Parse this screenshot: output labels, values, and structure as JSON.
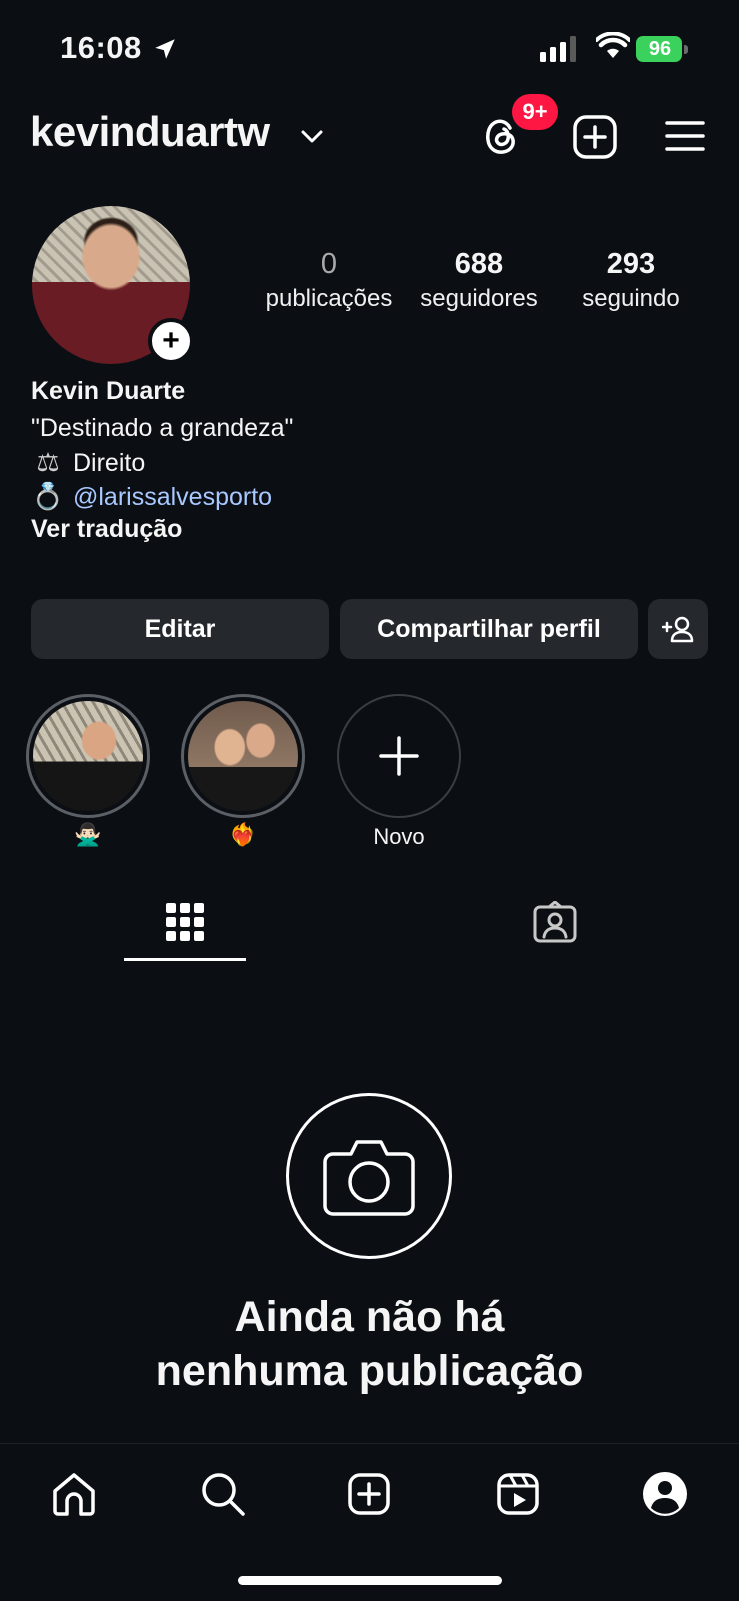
{
  "status_bar": {
    "time": "16:08",
    "battery": "96",
    "icons": [
      "location-arrow-icon",
      "cellular-signal-icon",
      "wifi-icon",
      "battery-charging-icon"
    ]
  },
  "header": {
    "username": "kevinduartw",
    "threads_badge": "9+",
    "icons": [
      "chevron-down-icon",
      "threads-icon",
      "new-post-icon",
      "menu-icon"
    ]
  },
  "profile": {
    "stats": [
      {
        "value": "0",
        "label": "publicações"
      },
      {
        "value": "688",
        "label": "seguidores"
      },
      {
        "value": "293",
        "label": "seguindo"
      }
    ],
    "name": "Kevin Duarte",
    "bio_line1": "\"Destinado a grandeza\"",
    "bio_line2": "Direito",
    "bio_line3_link": "@larissalvesporto",
    "see_translation": "Ver tradução"
  },
  "actions": {
    "edit": "Editar",
    "share": "Compartilhar perfil"
  },
  "highlights": [
    {
      "label": "🙅🏻‍♂️"
    },
    {
      "label": "❤️‍🔥"
    },
    {
      "label": "Novo"
    }
  ],
  "tabs": [
    "grid-icon",
    "tagged-icon"
  ],
  "empty_state": {
    "title_line1": "Ainda não há",
    "title_line2": "nenhuma publicação"
  },
  "bottom_nav": [
    "home-icon",
    "search-icon",
    "create-icon",
    "reels-icon",
    "profile-icon"
  ],
  "colors": {
    "background": "#0b0f14",
    "button": "#25292e",
    "badge": "#ff1744",
    "link": "#a8c8ff",
    "battery": "#3ad15d"
  }
}
